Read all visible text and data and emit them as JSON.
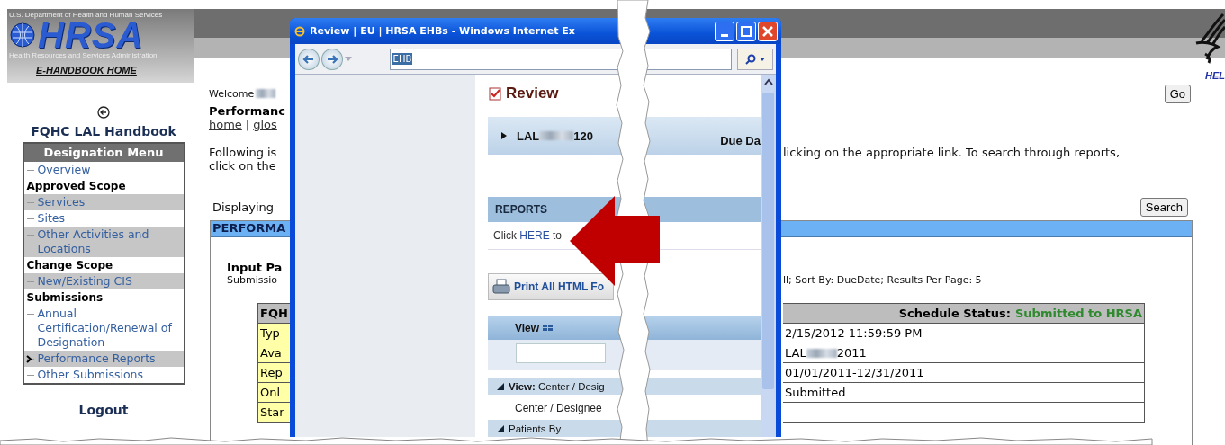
{
  "header": {
    "agency": "U.S. Department of Health and Human Services",
    "logo": "HRSA",
    "agency_full": "Health Resources and Services Administration",
    "home_link": "E-HANDBOOK HOME",
    "help": "HEL"
  },
  "sidebar": {
    "title": "FQHC LAL Handbook",
    "menu_title": "Designation Menu",
    "logout": "Logout",
    "items": [
      {
        "label": "Overview",
        "kind": "link",
        "shaded": false,
        "selected": false
      },
      {
        "label": "Approved Scope",
        "kind": "heading",
        "shaded": false,
        "selected": false
      },
      {
        "label": "Services",
        "kind": "link",
        "shaded": true,
        "selected": false
      },
      {
        "label": "Sites",
        "kind": "link",
        "shaded": false,
        "selected": false
      },
      {
        "label": "Other Activities and Locations",
        "kind": "link",
        "shaded": true,
        "selected": false
      },
      {
        "label": "Change Scope",
        "kind": "heading",
        "shaded": false,
        "selected": false
      },
      {
        "label": "New/Existing CIS",
        "kind": "link",
        "shaded": true,
        "selected": false
      },
      {
        "label": "Submissions",
        "kind": "heading",
        "shaded": false,
        "selected": false
      },
      {
        "label": "Annual Certification/Renewal of Designation",
        "kind": "link",
        "shaded": false,
        "selected": false
      },
      {
        "label": "Performance Reports",
        "kind": "link",
        "shaded": true,
        "selected": true
      },
      {
        "label": "Other Submissions",
        "kind": "link",
        "shaded": false,
        "selected": false
      }
    ]
  },
  "main": {
    "welcome": "Welcome",
    "title": "Performanc",
    "links": [
      "home",
      "glos"
    ],
    "link_separator": "|",
    "intro_left": [
      "Following is",
      "click on the"
    ],
    "intro_right": "licking on the appropriate link. To search through reports,",
    "go_button": "Go",
    "displaying": "Displaying",
    "search_button": "Search",
    "panel_title": "PERFORMA",
    "input_title": "Input Pa",
    "input_left": "Submissio",
    "input_right": "ll; Sort By: DueDate; Results Per Page: 5",
    "table": {
      "header_left": "FQH",
      "status_label": "Schedule Status:",
      "status_value": "Submitted to HRSA",
      "rows": [
        {
          "label": "Typ",
          "value": "2/15/2012 11:59:59 PM"
        },
        {
          "label": "Ava",
          "value": "LAL",
          "redacted": true,
          "value_after": "2011"
        },
        {
          "label": "Rep",
          "value": "01/01/2011-12/31/2011"
        },
        {
          "label": "Onl",
          "value": "Submitted"
        },
        {
          "label": "Star"
        }
      ]
    }
  },
  "popup": {
    "title": "Review | EU | HRSA EHBs - Windows Internet Ex",
    "address": "EHB",
    "heading": "Review",
    "record_id": "LAL",
    "record_suffix": "120",
    "due": "Due Da",
    "reports_title": "REPORTS",
    "click_before": "Click",
    "click_link": "HERE",
    "click_after": "to",
    "print_button": "Print All HTML Fo",
    "view_title": "View",
    "groups": [
      {
        "label": "View:",
        "value": "Center / Desig",
        "expanded": true,
        "children": [
          {
            "label": "Center / Designee"
          }
        ]
      },
      {
        "value": "Patients By",
        "expanded": true
      }
    ]
  }
}
